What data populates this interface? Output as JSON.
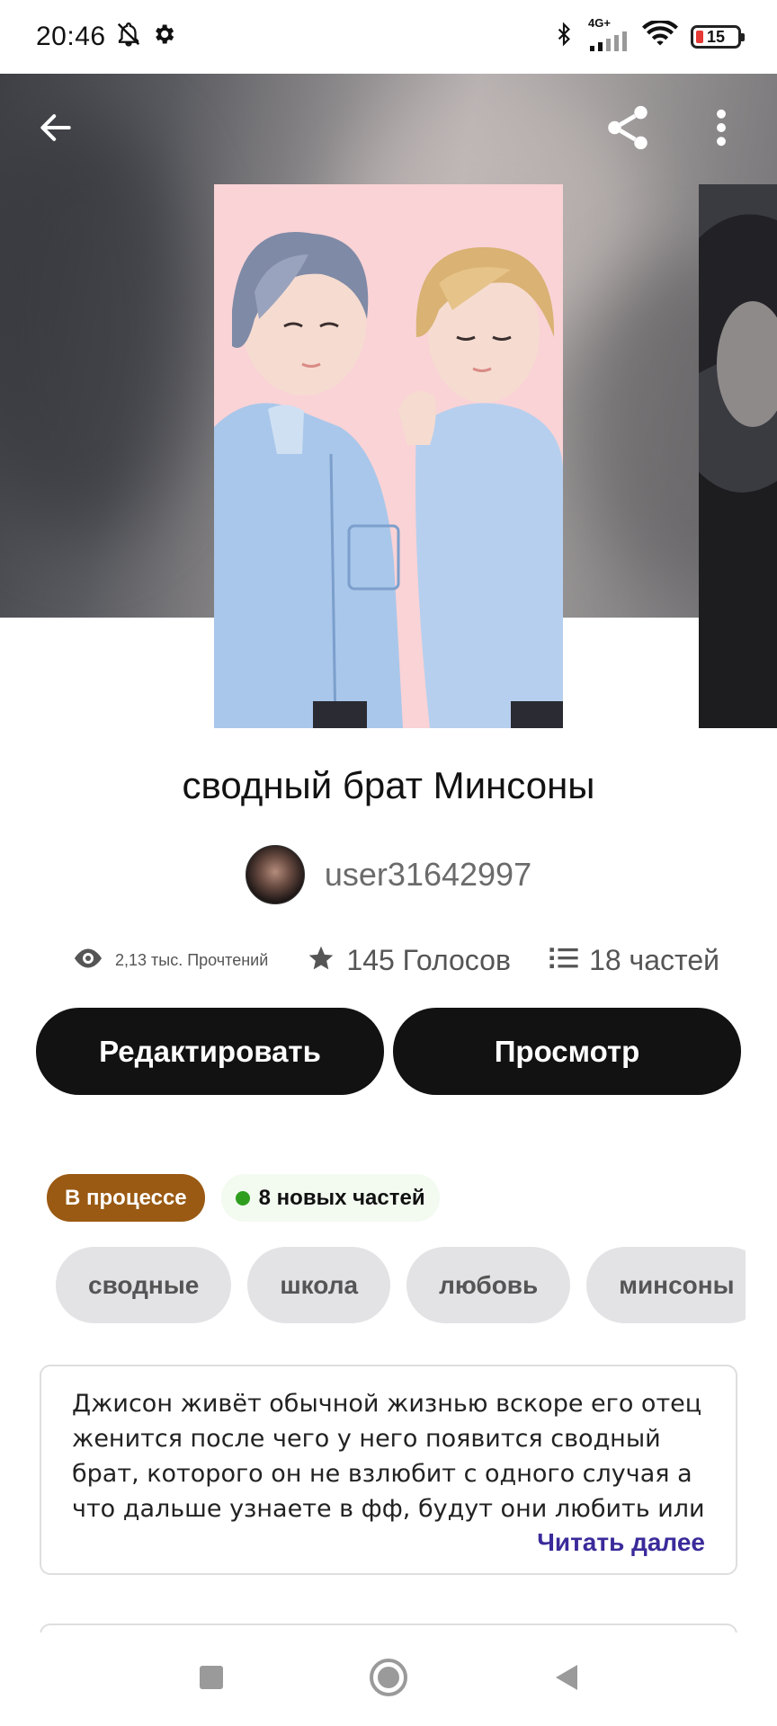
{
  "status_bar": {
    "time": "20:46",
    "network": "4G+",
    "battery_level": "15",
    "icons": [
      "bell-off-icon",
      "settings-icon",
      "bluetooth-icon",
      "signal-icon",
      "wifi-icon",
      "battery-icon"
    ]
  },
  "app_bar": {
    "icons": [
      "back-arrow-icon",
      "share-icon",
      "more-vert-icon"
    ]
  },
  "story": {
    "title": "сводный брат Минсоны",
    "author": "user31642997"
  },
  "stats": {
    "reads": "2,13 тыс. Прочтений",
    "votes": "145 Голосов",
    "parts": "18 частей"
  },
  "buttons": {
    "edit": "Редактировать",
    "preview": "Просмотр"
  },
  "status_chips": {
    "status": "В процессе",
    "new_parts": "8 новых частей"
  },
  "tags": [
    "сводные",
    "школа",
    "любовь",
    "минсоны"
  ],
  "description": {
    "text": "Джисон живёт обычной жизнью вскоре его отец женится после чего у него появится сводный брат, которого он не взлюбит с одного случая а что дальше узнаете в фф, будут они любить или",
    "read_more": "Читать далее"
  },
  "colors": {
    "button_bg": "#121212",
    "status_chip_bg": "#9a5a13",
    "new_chip_bg": "#f3fbf1",
    "new_dot": "#2f9e1f",
    "tag_bg": "#e3e3e6",
    "read_more": "#3a2a9a"
  }
}
